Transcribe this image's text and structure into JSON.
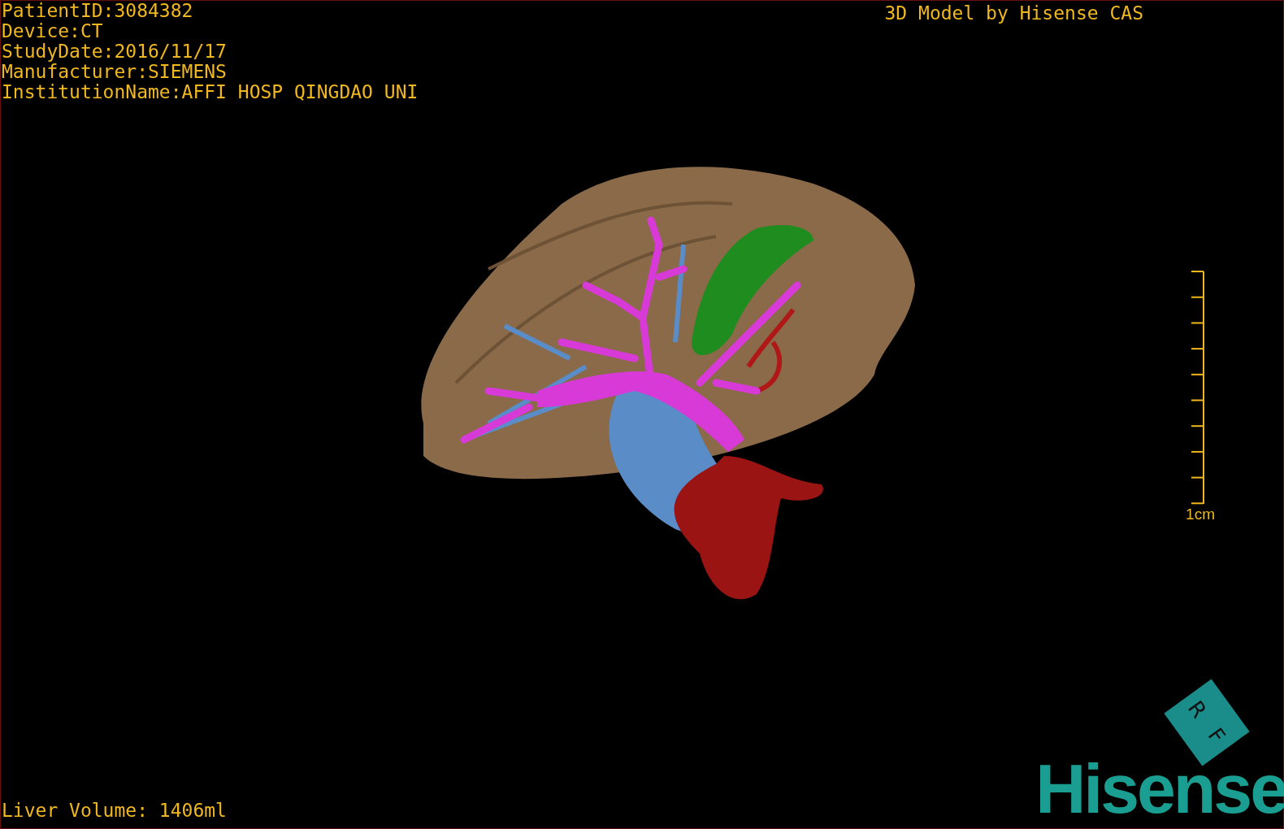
{
  "info_lines": [
    "PatientID:3084382",
    "Device:CT",
    "StudyDate:2016/11/17",
    "Manufacturer:SIEMENS",
    "InstitutionName:AFFI HOSP QINGDAO UNI"
  ],
  "title": "3D Model by Hisense CAS",
  "scale_label": "1cm",
  "volume": "Liver Volume: 1406ml",
  "orientation": [
    "R",
    "F"
  ],
  "logo": "Hisense"
}
